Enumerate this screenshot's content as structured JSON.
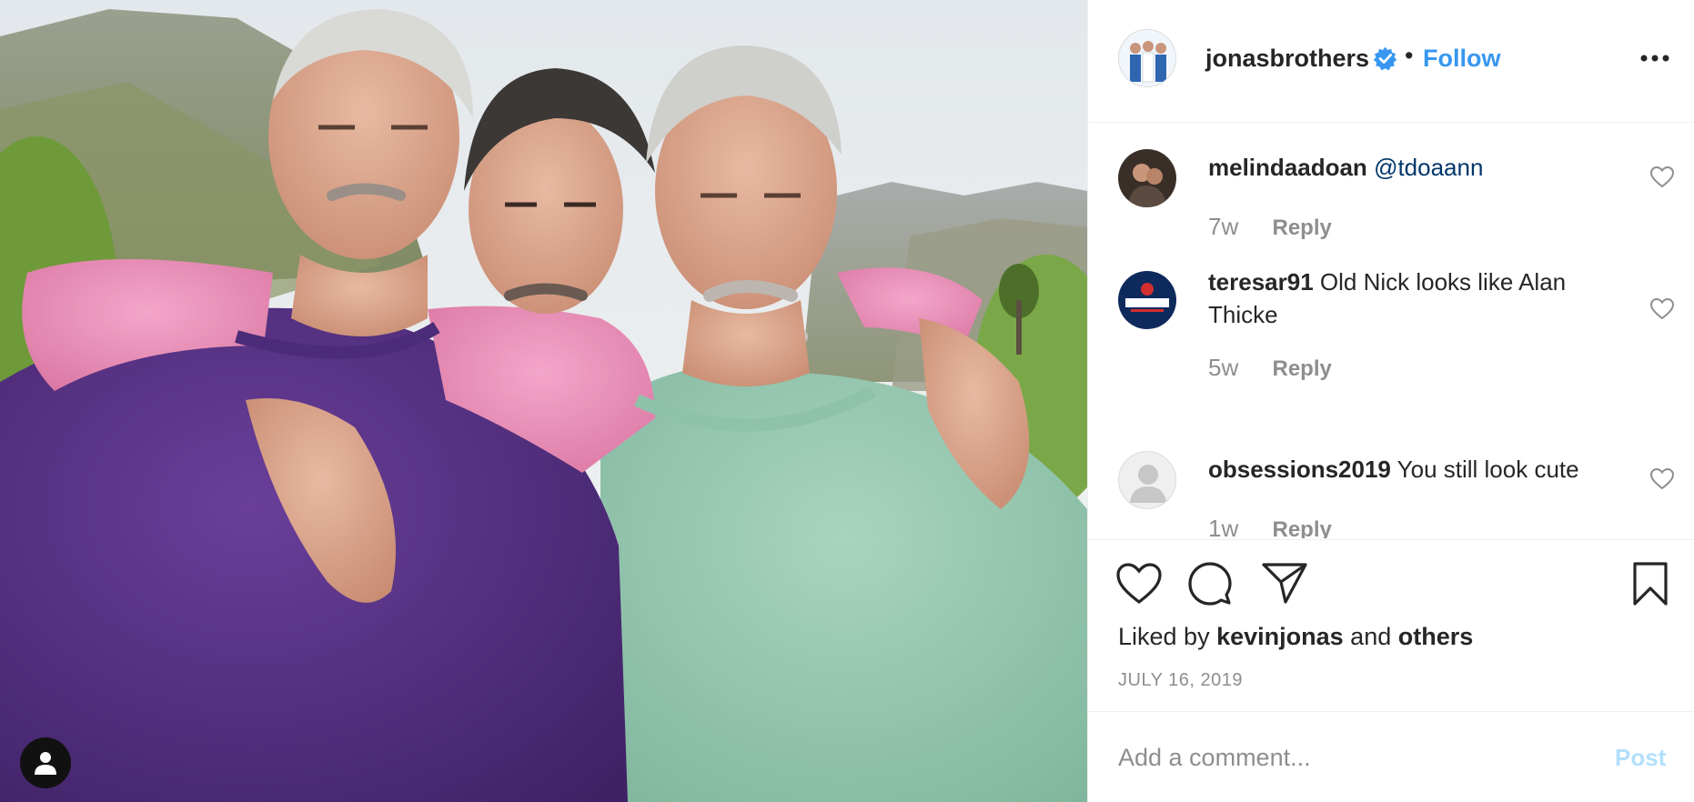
{
  "post": {
    "image_alt": "Photo of three men in sweaters (purple, pink, mint green) in front of mountains",
    "user_tag_icon": "user-icon"
  },
  "header": {
    "username": "jonasbrothers",
    "separator": "•",
    "follow_label": "Follow",
    "verified_icon": "verified-badge-icon",
    "more_icon": "more-options-icon"
  },
  "comments": [
    {
      "username": "melindaadoan",
      "mention": "@tdoaann",
      "text": "",
      "age": "7w",
      "reply_label": "Reply"
    },
    {
      "username": "teresar91",
      "mention": "",
      "text": "Old Nick looks like Alan Thicke",
      "age": "5w",
      "reply_label": "Reply"
    },
    {
      "username": "obsessions2019",
      "mention": "",
      "text": "You still look cute",
      "age": "1w",
      "reply_label": "Reply"
    }
  ],
  "actions": {
    "liked_prefix": "Liked by",
    "liked_user": "kevinjonas",
    "liked_and": "and",
    "liked_others": "others",
    "date": "JULY 16, 2019"
  },
  "add_comment": {
    "placeholder": "Add a comment...",
    "post_label": "Post"
  },
  "colors": {
    "link_blue": "#3897f0",
    "post_disabled": "#b2dffc",
    "mention": "#00376b",
    "muted": "#8e8e8e"
  }
}
